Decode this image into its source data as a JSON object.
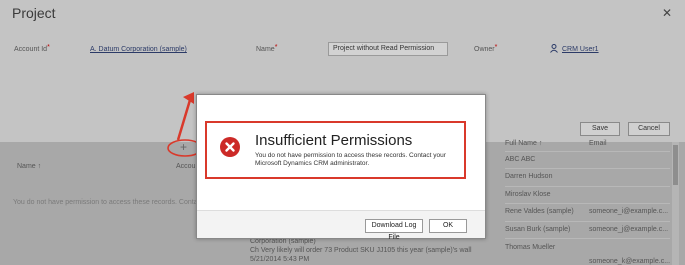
{
  "form": {
    "title": "Project",
    "close_icon": "✕",
    "account_label": "Account Id",
    "account_value": "A. Datum Corporation (sample)",
    "name_label": "Name",
    "name_value": "Project without Read Permission",
    "owner_label": "Owner",
    "owner_value": "CRM User1",
    "required_marker": "*",
    "save_label": "Save",
    "cancel_label": "Cancel"
  },
  "grid": {
    "add_icon": "+",
    "col_name": "Name ↑",
    "col_account": "Accou",
    "empty_message": "You do not have permission to access these records. Contact..."
  },
  "right_list": {
    "header_name": "Full Name ↑",
    "header_email": "Email",
    "rows": [
      {
        "name": "ABC ABC",
        "email": ""
      },
      {
        "name": "Darren Hudson",
        "email": ""
      },
      {
        "name": "Miroslav Klose",
        "email": ""
      },
      {
        "name": "Rene Valdes (sample)",
        "email": "someone_i@example.c..."
      },
      {
        "name": "Susan Burk (sample)",
        "email": "someone_j@example.c..."
      },
      {
        "name": "Thomas Mueller",
        "email": ""
      },
      {
        "name": "",
        "email": "someone_k@example.c..."
      }
    ]
  },
  "activity": {
    "line1": "Corporation (sample)",
    "line2": "Ch Very likely will order 73 Product SKU JJ105 this year (sample)'s wall",
    "line3": "5/21/2014 5:43 PM"
  },
  "dialog": {
    "title": "Insufficient Permissions",
    "message": "You do not have permission to access these records. Contact your Microsoft Dynamics CRM administrator.",
    "download_label": "Download Log File",
    "ok_label": "OK"
  },
  "colors": {
    "annotation_red": "#d9392b",
    "error_icon": "#cc2a27"
  }
}
